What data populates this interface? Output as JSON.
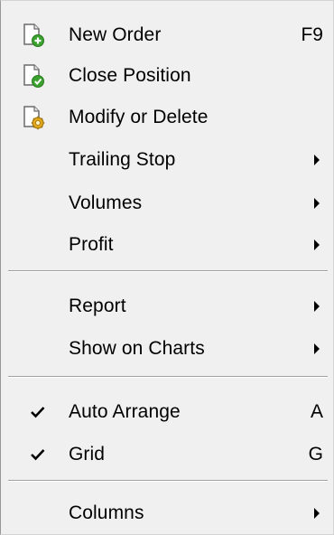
{
  "menu": {
    "new_order": {
      "label": "New Order",
      "shortcut": "F9",
      "icon": "new-order-doc-plus-icon"
    },
    "close_position": {
      "label": "Close Position",
      "icon": "close-position-doc-check-icon"
    },
    "modify_or_delete": {
      "label": "Modify or Delete",
      "icon": "modify-doc-gear-icon"
    },
    "trailing_stop": {
      "label": "Trailing Stop",
      "submenu": true
    },
    "volumes": {
      "label": "Volumes",
      "submenu": true
    },
    "profit": {
      "label": "Profit",
      "submenu": true
    },
    "report": {
      "label": "Report",
      "submenu": true
    },
    "show_on_charts": {
      "label": "Show on Charts",
      "submenu": true
    },
    "auto_arrange": {
      "label": "Auto Arrange",
      "shortcut": "A",
      "checked": true
    },
    "grid": {
      "label": "Grid",
      "shortcut": "G",
      "checked": true
    },
    "columns": {
      "label": "Columns",
      "submenu": true
    }
  },
  "colors": {
    "menu_background": "#f0f0f0",
    "separator": "#a0a0a0",
    "plus_badge": "#3aa12e",
    "check_badge": "#3aa12e",
    "gear_badge": "#e0a81e"
  }
}
